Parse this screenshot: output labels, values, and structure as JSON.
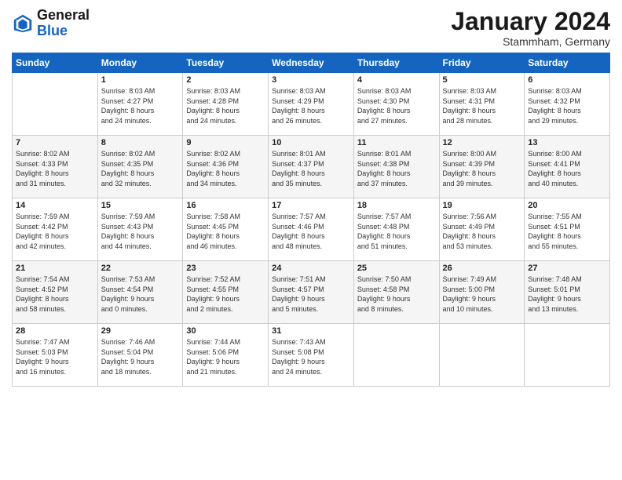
{
  "logo": {
    "line1": "General",
    "line2": "Blue"
  },
  "title": "January 2024",
  "location": "Stammham, Germany",
  "days_header": [
    "Sunday",
    "Monday",
    "Tuesday",
    "Wednesday",
    "Thursday",
    "Friday",
    "Saturday"
  ],
  "weeks": [
    [
      {
        "day": "",
        "info": ""
      },
      {
        "day": "1",
        "info": "Sunrise: 8:03 AM\nSunset: 4:27 PM\nDaylight: 8 hours\nand 24 minutes."
      },
      {
        "day": "2",
        "info": "Sunrise: 8:03 AM\nSunset: 4:28 PM\nDaylight: 8 hours\nand 24 minutes."
      },
      {
        "day": "3",
        "info": "Sunrise: 8:03 AM\nSunset: 4:29 PM\nDaylight: 8 hours\nand 26 minutes."
      },
      {
        "day": "4",
        "info": "Sunrise: 8:03 AM\nSunset: 4:30 PM\nDaylight: 8 hours\nand 27 minutes."
      },
      {
        "day": "5",
        "info": "Sunrise: 8:03 AM\nSunset: 4:31 PM\nDaylight: 8 hours\nand 28 minutes."
      },
      {
        "day": "6",
        "info": "Sunrise: 8:03 AM\nSunset: 4:32 PM\nDaylight: 8 hours\nand 29 minutes."
      }
    ],
    [
      {
        "day": "7",
        "info": "Sunrise: 8:02 AM\nSunset: 4:33 PM\nDaylight: 8 hours\nand 31 minutes."
      },
      {
        "day": "8",
        "info": "Sunrise: 8:02 AM\nSunset: 4:35 PM\nDaylight: 8 hours\nand 32 minutes."
      },
      {
        "day": "9",
        "info": "Sunrise: 8:02 AM\nSunset: 4:36 PM\nDaylight: 8 hours\nand 34 minutes."
      },
      {
        "day": "10",
        "info": "Sunrise: 8:01 AM\nSunset: 4:37 PM\nDaylight: 8 hours\nand 35 minutes."
      },
      {
        "day": "11",
        "info": "Sunrise: 8:01 AM\nSunset: 4:38 PM\nDaylight: 8 hours\nand 37 minutes."
      },
      {
        "day": "12",
        "info": "Sunrise: 8:00 AM\nSunset: 4:39 PM\nDaylight: 8 hours\nand 39 minutes."
      },
      {
        "day": "13",
        "info": "Sunrise: 8:00 AM\nSunset: 4:41 PM\nDaylight: 8 hours\nand 40 minutes."
      }
    ],
    [
      {
        "day": "14",
        "info": "Sunrise: 7:59 AM\nSunset: 4:42 PM\nDaylight: 8 hours\nand 42 minutes."
      },
      {
        "day": "15",
        "info": "Sunrise: 7:59 AM\nSunset: 4:43 PM\nDaylight: 8 hours\nand 44 minutes."
      },
      {
        "day": "16",
        "info": "Sunrise: 7:58 AM\nSunset: 4:45 PM\nDaylight: 8 hours\nand 46 minutes."
      },
      {
        "day": "17",
        "info": "Sunrise: 7:57 AM\nSunset: 4:46 PM\nDaylight: 8 hours\nand 48 minutes."
      },
      {
        "day": "18",
        "info": "Sunrise: 7:57 AM\nSunset: 4:48 PM\nDaylight: 8 hours\nand 51 minutes."
      },
      {
        "day": "19",
        "info": "Sunrise: 7:56 AM\nSunset: 4:49 PM\nDaylight: 8 hours\nand 53 minutes."
      },
      {
        "day": "20",
        "info": "Sunrise: 7:55 AM\nSunset: 4:51 PM\nDaylight: 8 hours\nand 55 minutes."
      }
    ],
    [
      {
        "day": "21",
        "info": "Sunrise: 7:54 AM\nSunset: 4:52 PM\nDaylight: 8 hours\nand 58 minutes."
      },
      {
        "day": "22",
        "info": "Sunrise: 7:53 AM\nSunset: 4:54 PM\nDaylight: 9 hours\nand 0 minutes."
      },
      {
        "day": "23",
        "info": "Sunrise: 7:52 AM\nSunset: 4:55 PM\nDaylight: 9 hours\nand 2 minutes."
      },
      {
        "day": "24",
        "info": "Sunrise: 7:51 AM\nSunset: 4:57 PM\nDaylight: 9 hours\nand 5 minutes."
      },
      {
        "day": "25",
        "info": "Sunrise: 7:50 AM\nSunset: 4:58 PM\nDaylight: 9 hours\nand 8 minutes."
      },
      {
        "day": "26",
        "info": "Sunrise: 7:49 AM\nSunset: 5:00 PM\nDaylight: 9 hours\nand 10 minutes."
      },
      {
        "day": "27",
        "info": "Sunrise: 7:48 AM\nSunset: 5:01 PM\nDaylight: 9 hours\nand 13 minutes."
      }
    ],
    [
      {
        "day": "28",
        "info": "Sunrise: 7:47 AM\nSunset: 5:03 PM\nDaylight: 9 hours\nand 16 minutes."
      },
      {
        "day": "29",
        "info": "Sunrise: 7:46 AM\nSunset: 5:04 PM\nDaylight: 9 hours\nand 18 minutes."
      },
      {
        "day": "30",
        "info": "Sunrise: 7:44 AM\nSunset: 5:06 PM\nDaylight: 9 hours\nand 21 minutes."
      },
      {
        "day": "31",
        "info": "Sunrise: 7:43 AM\nSunset: 5:08 PM\nDaylight: 9 hours\nand 24 minutes."
      },
      {
        "day": "",
        "info": ""
      },
      {
        "day": "",
        "info": ""
      },
      {
        "day": "",
        "info": ""
      }
    ]
  ]
}
